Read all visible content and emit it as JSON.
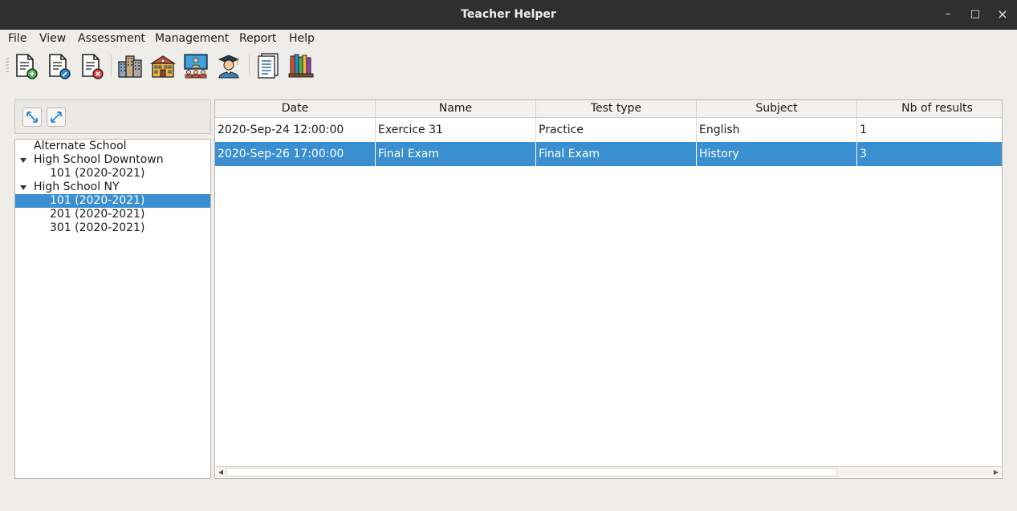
{
  "window": {
    "title": "Teacher Helper",
    "minimize_glyph": "–",
    "maximize_glyph": "□",
    "close_glyph": "×"
  },
  "menu": {
    "file": "File",
    "view": "View",
    "assessment": "Assessment",
    "management": "Management",
    "report": "Report",
    "help": "Help"
  },
  "toolbar": {
    "icons": [
      "new-document-icon",
      "edit-document-icon",
      "delete-document-icon",
      "schools-buildings-icon",
      "school-icon",
      "classroom-icon",
      "student-graduate-icon",
      "report-document-icon",
      "books-shelf-icon"
    ]
  },
  "tree": {
    "items": [
      {
        "label": "Alternate School",
        "level": 0,
        "expandable": false,
        "selected": false
      },
      {
        "label": "High School Downtown",
        "level": 0,
        "expandable": true,
        "selected": false
      },
      {
        "label": "101 (2020-2021)",
        "level": 1,
        "expandable": false,
        "selected": false
      },
      {
        "label": "High School NY",
        "level": 0,
        "expandable": true,
        "selected": false
      },
      {
        "label": "101 (2020-2021)",
        "level": 1,
        "expandable": false,
        "selected": true
      },
      {
        "label": "201 (2020-2021)",
        "level": 1,
        "expandable": false,
        "selected": false
      },
      {
        "label": "301 (2020-2021)",
        "level": 1,
        "expandable": false,
        "selected": false
      }
    ]
  },
  "table": {
    "columns": [
      "Date",
      "Name",
      "Test type",
      "Subject",
      "Nb of results"
    ],
    "rows": [
      {
        "cells": [
          "2020-Sep-24 12:00:00",
          "Exercice 31",
          "Practice",
          "English",
          "1"
        ],
        "selected": false
      },
      {
        "cells": [
          "2020-Sep-26 17:00:00",
          "Final Exam",
          "Final Exam",
          "History",
          "3"
        ],
        "selected": true
      }
    ]
  },
  "scrollbar": {
    "left_arrow": "◀",
    "right_arrow": "▶"
  },
  "colors": {
    "selection": "#3a8fd0",
    "titlebar": "#2f2f2f",
    "window_bg": "#efedea"
  }
}
